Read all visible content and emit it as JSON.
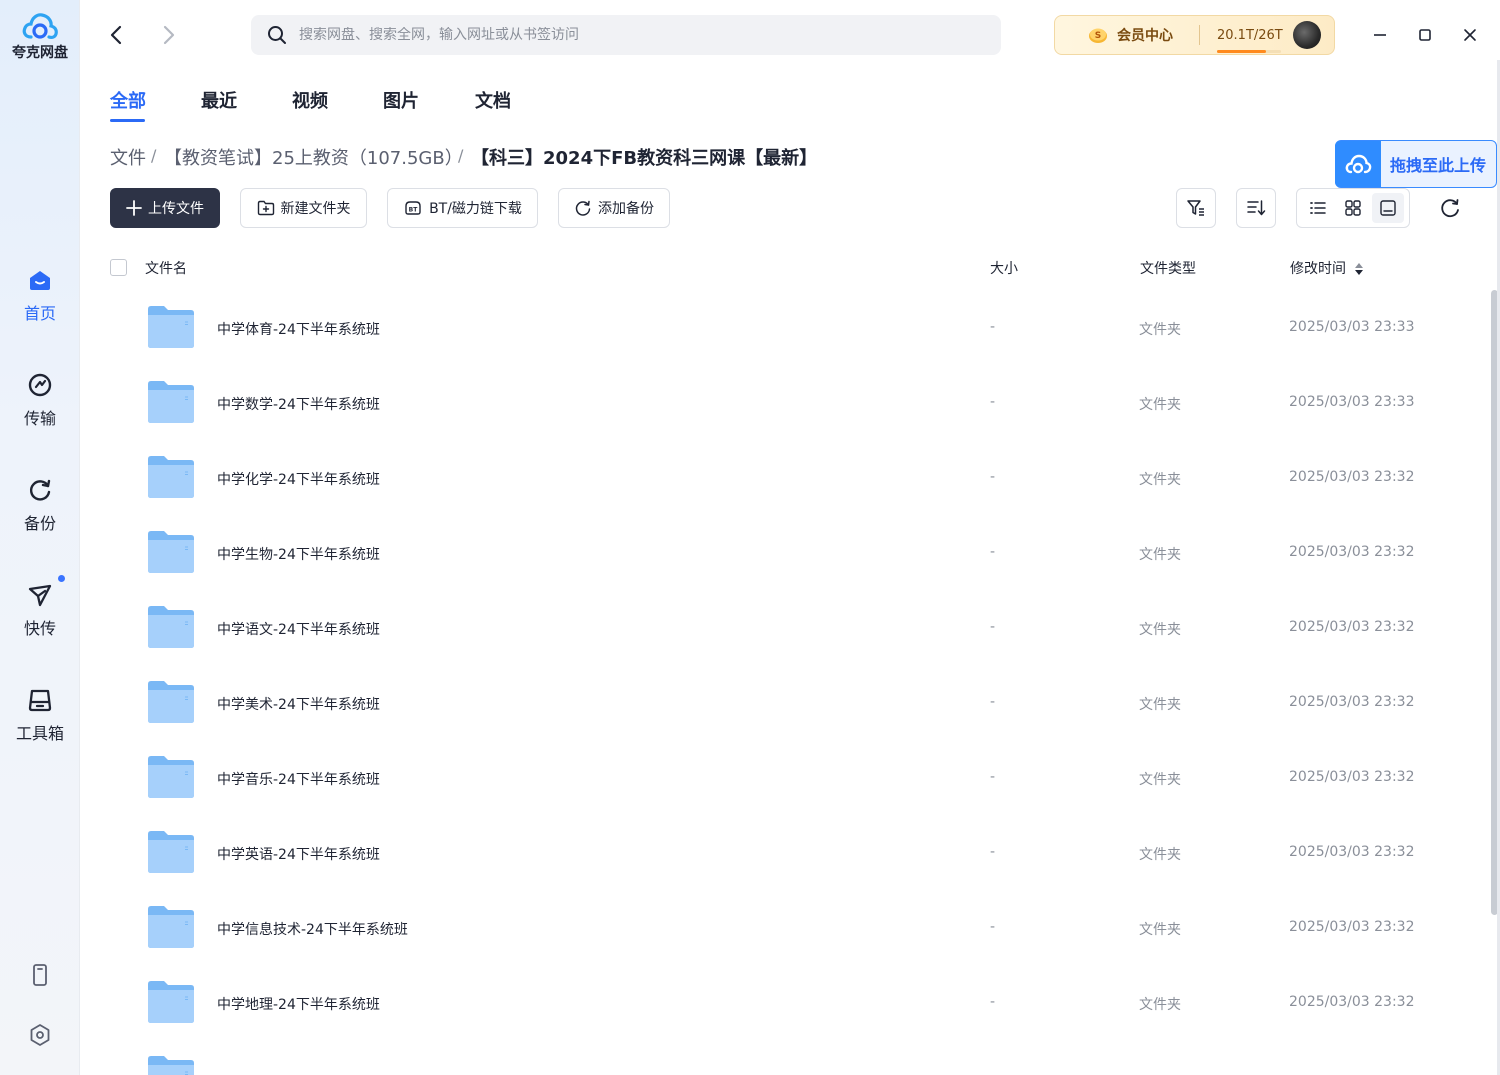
{
  "app": {
    "name": "夸克网盘"
  },
  "sidebar": {
    "items": [
      {
        "label": "首页",
        "icon": "home-icon",
        "active": true
      },
      {
        "label": "传输",
        "icon": "transfer-icon",
        "active": false
      },
      {
        "label": "备份",
        "icon": "backup-icon",
        "active": false
      },
      {
        "label": "快传",
        "icon": "quick-send-icon",
        "active": false,
        "badge_dot": true
      },
      {
        "label": "工具箱",
        "icon": "toolbox-icon",
        "active": false
      }
    ],
    "bottom_icons": [
      "phone-icon",
      "settings-icon"
    ]
  },
  "topbar": {
    "search_placeholder": "搜索网盘、搜索全网，输入网址或从书签访问",
    "member_label": "会员中心",
    "storage": "20.1T/26T",
    "storage_used_fraction": 0.77
  },
  "tabs": [
    {
      "label": "全部",
      "active": true
    },
    {
      "label": "最近",
      "active": false
    },
    {
      "label": "视频",
      "active": false
    },
    {
      "label": "图片",
      "active": false
    },
    {
      "label": "文档",
      "active": false
    }
  ],
  "breadcrumb": {
    "root": "文件",
    "middle": "【教资笔试】25上教资（107.5GB）",
    "current": "【科三】2024下FB教资科三网课【最新】"
  },
  "drag_upload_label": "拖拽至此上传",
  "toolbar": {
    "upload": "上传文件",
    "new_folder": "新建文件夹",
    "bt_download": "BT/磁力链下载",
    "add_backup": "添加备份"
  },
  "table": {
    "headers": {
      "name": "文件名",
      "size": "大小",
      "type": "文件类型",
      "modified": "修改时间"
    },
    "rows": [
      {
        "name": "中学体育-24下半年系统班",
        "size": "-",
        "type": "文件夹",
        "modified": "2025/03/03 23:33"
      },
      {
        "name": "中学数学-24下半年系统班",
        "size": "-",
        "type": "文件夹",
        "modified": "2025/03/03 23:33"
      },
      {
        "name": "中学化学-24下半年系统班",
        "size": "-",
        "type": "文件夹",
        "modified": "2025/03/03 23:32"
      },
      {
        "name": "中学生物-24下半年系统班",
        "size": "-",
        "type": "文件夹",
        "modified": "2025/03/03 23:32"
      },
      {
        "name": "中学语文-24下半年系统班",
        "size": "-",
        "type": "文件夹",
        "modified": "2025/03/03 23:32"
      },
      {
        "name": "中学美术-24下半年系统班",
        "size": "-",
        "type": "文件夹",
        "modified": "2025/03/03 23:32"
      },
      {
        "name": "中学音乐-24下半年系统班",
        "size": "-",
        "type": "文件夹",
        "modified": "2025/03/03 23:32"
      },
      {
        "name": "中学英语-24下半年系统班",
        "size": "-",
        "type": "文件夹",
        "modified": "2025/03/03 23:32"
      },
      {
        "name": "中学信息技术-24下半年系统班",
        "size": "-",
        "type": "文件夹",
        "modified": "2025/03/03 23:32"
      },
      {
        "name": "中学地理-24下半年系统班",
        "size": "-",
        "type": "文件夹",
        "modified": "2025/03/03 23:32"
      }
    ]
  },
  "colors": {
    "accent": "#2b6af6",
    "primary_button": "#2d3346",
    "folder": "#7ab8f5"
  }
}
